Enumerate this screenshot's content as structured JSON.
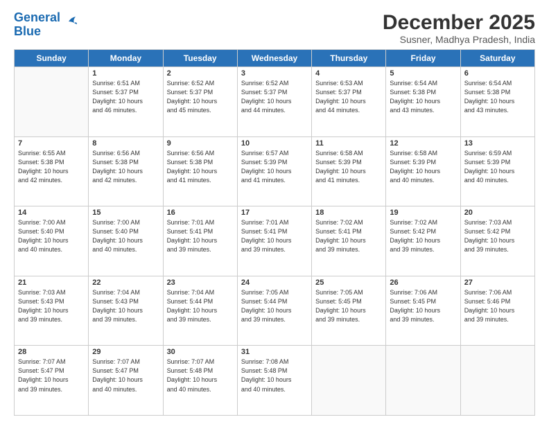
{
  "header": {
    "logo_line1": "General",
    "logo_line2": "Blue",
    "title": "December 2025",
    "subtitle": "Susner, Madhya Pradesh, India"
  },
  "columns": [
    "Sunday",
    "Monday",
    "Tuesday",
    "Wednesday",
    "Thursday",
    "Friday",
    "Saturday"
  ],
  "weeks": [
    [
      {
        "day": "",
        "info": ""
      },
      {
        "day": "1",
        "info": "Sunrise: 6:51 AM\nSunset: 5:37 PM\nDaylight: 10 hours\nand 46 minutes."
      },
      {
        "day": "2",
        "info": "Sunrise: 6:52 AM\nSunset: 5:37 PM\nDaylight: 10 hours\nand 45 minutes."
      },
      {
        "day": "3",
        "info": "Sunrise: 6:52 AM\nSunset: 5:37 PM\nDaylight: 10 hours\nand 44 minutes."
      },
      {
        "day": "4",
        "info": "Sunrise: 6:53 AM\nSunset: 5:37 PM\nDaylight: 10 hours\nand 44 minutes."
      },
      {
        "day": "5",
        "info": "Sunrise: 6:54 AM\nSunset: 5:38 PM\nDaylight: 10 hours\nand 43 minutes."
      },
      {
        "day": "6",
        "info": "Sunrise: 6:54 AM\nSunset: 5:38 PM\nDaylight: 10 hours\nand 43 minutes."
      }
    ],
    [
      {
        "day": "7",
        "info": "Sunrise: 6:55 AM\nSunset: 5:38 PM\nDaylight: 10 hours\nand 42 minutes."
      },
      {
        "day": "8",
        "info": "Sunrise: 6:56 AM\nSunset: 5:38 PM\nDaylight: 10 hours\nand 42 minutes."
      },
      {
        "day": "9",
        "info": "Sunrise: 6:56 AM\nSunset: 5:38 PM\nDaylight: 10 hours\nand 41 minutes."
      },
      {
        "day": "10",
        "info": "Sunrise: 6:57 AM\nSunset: 5:39 PM\nDaylight: 10 hours\nand 41 minutes."
      },
      {
        "day": "11",
        "info": "Sunrise: 6:58 AM\nSunset: 5:39 PM\nDaylight: 10 hours\nand 41 minutes."
      },
      {
        "day": "12",
        "info": "Sunrise: 6:58 AM\nSunset: 5:39 PM\nDaylight: 10 hours\nand 40 minutes."
      },
      {
        "day": "13",
        "info": "Sunrise: 6:59 AM\nSunset: 5:39 PM\nDaylight: 10 hours\nand 40 minutes."
      }
    ],
    [
      {
        "day": "14",
        "info": "Sunrise: 7:00 AM\nSunset: 5:40 PM\nDaylight: 10 hours\nand 40 minutes."
      },
      {
        "day": "15",
        "info": "Sunrise: 7:00 AM\nSunset: 5:40 PM\nDaylight: 10 hours\nand 40 minutes."
      },
      {
        "day": "16",
        "info": "Sunrise: 7:01 AM\nSunset: 5:41 PM\nDaylight: 10 hours\nand 39 minutes."
      },
      {
        "day": "17",
        "info": "Sunrise: 7:01 AM\nSunset: 5:41 PM\nDaylight: 10 hours\nand 39 minutes."
      },
      {
        "day": "18",
        "info": "Sunrise: 7:02 AM\nSunset: 5:41 PM\nDaylight: 10 hours\nand 39 minutes."
      },
      {
        "day": "19",
        "info": "Sunrise: 7:02 AM\nSunset: 5:42 PM\nDaylight: 10 hours\nand 39 minutes."
      },
      {
        "day": "20",
        "info": "Sunrise: 7:03 AM\nSunset: 5:42 PM\nDaylight: 10 hours\nand 39 minutes."
      }
    ],
    [
      {
        "day": "21",
        "info": "Sunrise: 7:03 AM\nSunset: 5:43 PM\nDaylight: 10 hours\nand 39 minutes."
      },
      {
        "day": "22",
        "info": "Sunrise: 7:04 AM\nSunset: 5:43 PM\nDaylight: 10 hours\nand 39 minutes."
      },
      {
        "day": "23",
        "info": "Sunrise: 7:04 AM\nSunset: 5:44 PM\nDaylight: 10 hours\nand 39 minutes."
      },
      {
        "day": "24",
        "info": "Sunrise: 7:05 AM\nSunset: 5:44 PM\nDaylight: 10 hours\nand 39 minutes."
      },
      {
        "day": "25",
        "info": "Sunrise: 7:05 AM\nSunset: 5:45 PM\nDaylight: 10 hours\nand 39 minutes."
      },
      {
        "day": "26",
        "info": "Sunrise: 7:06 AM\nSunset: 5:45 PM\nDaylight: 10 hours\nand 39 minutes."
      },
      {
        "day": "27",
        "info": "Sunrise: 7:06 AM\nSunset: 5:46 PM\nDaylight: 10 hours\nand 39 minutes."
      }
    ],
    [
      {
        "day": "28",
        "info": "Sunrise: 7:07 AM\nSunset: 5:47 PM\nDaylight: 10 hours\nand 39 minutes."
      },
      {
        "day": "29",
        "info": "Sunrise: 7:07 AM\nSunset: 5:47 PM\nDaylight: 10 hours\nand 40 minutes."
      },
      {
        "day": "30",
        "info": "Sunrise: 7:07 AM\nSunset: 5:48 PM\nDaylight: 10 hours\nand 40 minutes."
      },
      {
        "day": "31",
        "info": "Sunrise: 7:08 AM\nSunset: 5:48 PM\nDaylight: 10 hours\nand 40 minutes."
      },
      {
        "day": "",
        "info": ""
      },
      {
        "day": "",
        "info": ""
      },
      {
        "day": "",
        "info": ""
      }
    ]
  ]
}
